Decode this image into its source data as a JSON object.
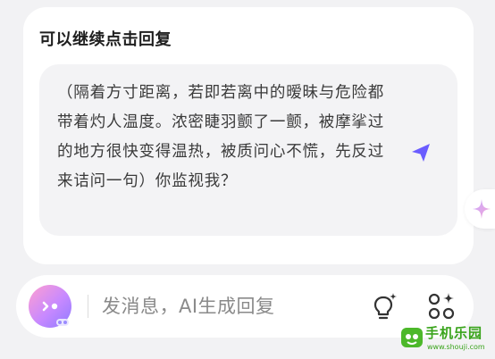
{
  "card": {
    "title": "可以继续点击回复",
    "reply_text": "（隔着方寸距离，若即若离中的暧昧与危险都带着灼人温度。浓密睫羽颤了一颤，被摩挲过的地方很快变得温热，被质问心不慌，先反过来诘问一句）你监视我？"
  },
  "input_bar": {
    "placeholder": "发消息，AI生成回复"
  },
  "icons": {
    "send": "send-arrow-icon",
    "sparkle": "sparkle-icon",
    "bulb": "lightbulb-icon",
    "grid": "apps-grid-icon",
    "avatar": "character-avatar"
  },
  "watermark": {
    "text": "手机乐园",
    "url": "www.shouji.com"
  },
  "colors": {
    "accent_purple": "#6a5cff",
    "watermark_green": "#3aa41c"
  }
}
